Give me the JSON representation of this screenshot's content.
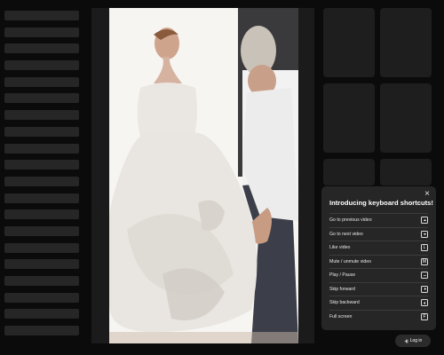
{
  "popup": {
    "title": "Introducing keyboard shortcuts!",
    "close_glyph": "×",
    "shortcuts": [
      {
        "label": "Go to previous video",
        "key": "",
        "key_icon": "arrow-up-icon"
      },
      {
        "label": "Go to next video",
        "key": "",
        "key_icon": "arrow-down-icon"
      },
      {
        "label": "Like video",
        "key": "L",
        "key_icon": ""
      },
      {
        "label": "Mute / unmute video",
        "key": "M",
        "key_icon": ""
      },
      {
        "label": "Play / Pause",
        "key": "",
        "key_icon": "space-bar-icon"
      },
      {
        "label": "Skip forward",
        "key": "",
        "key_icon": "arrow-right-icon"
      },
      {
        "label": "Skip backward",
        "key": "",
        "key_icon": "arrow-left-icon"
      },
      {
        "label": "Full screen",
        "key": "F",
        "key_icon": ""
      }
    ]
  },
  "login": {
    "label": "Log in",
    "icon": "login-icon"
  },
  "colors": {
    "background": "#0b0b0b",
    "popup": "#262626",
    "skeleton": "#262626",
    "thumbnail": "#1e1e1e"
  }
}
